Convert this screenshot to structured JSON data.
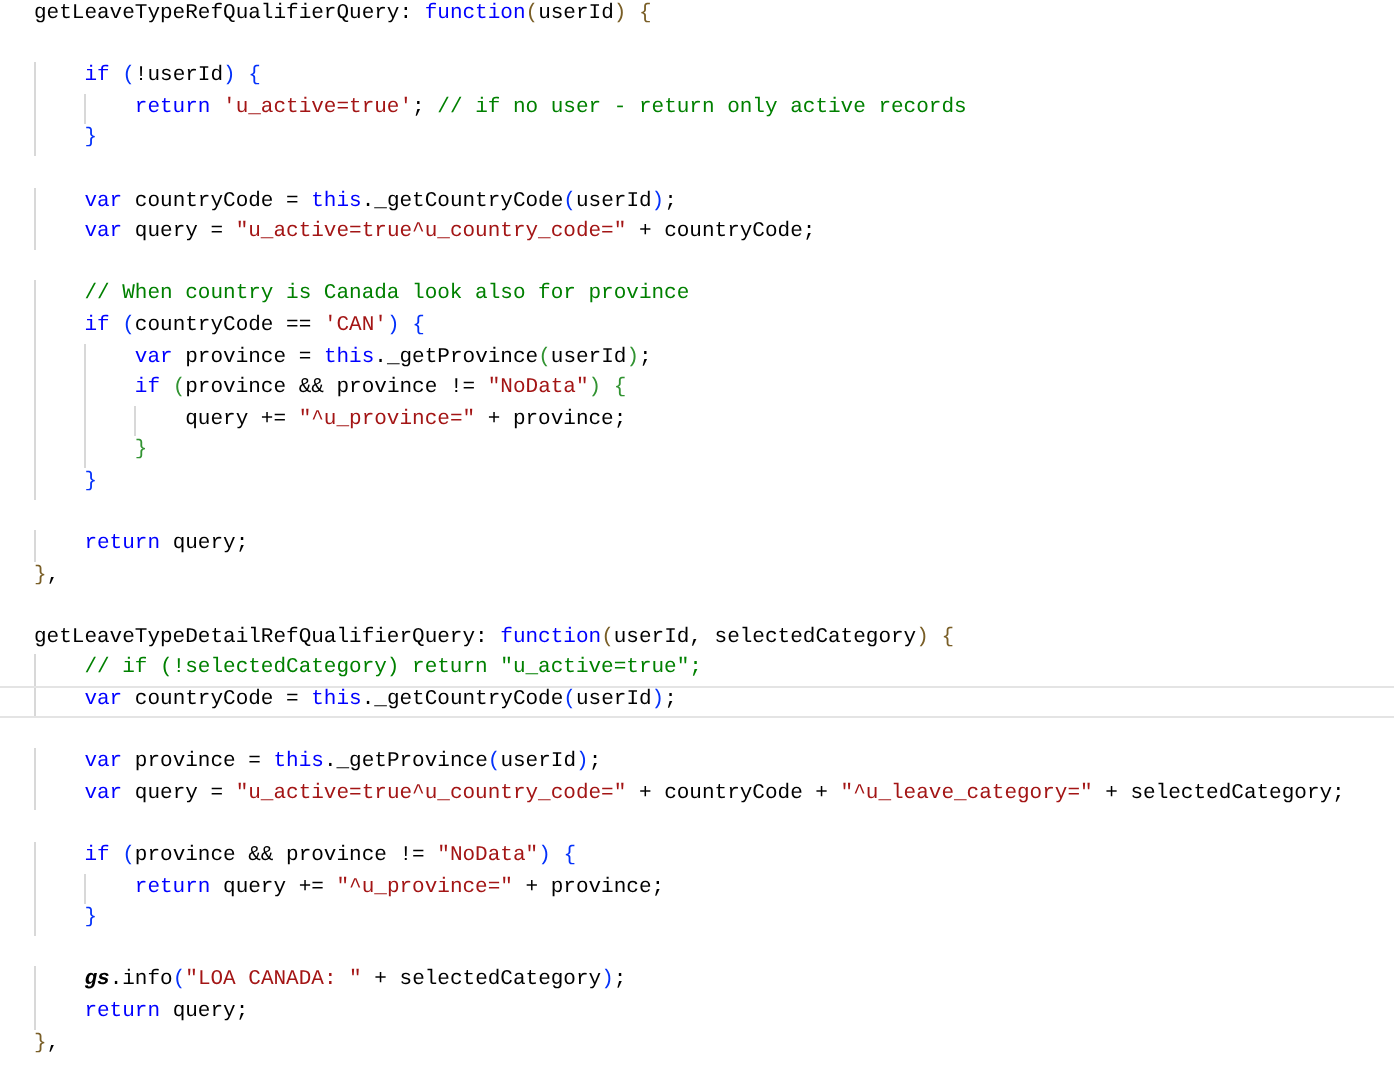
{
  "editor": {
    "lines": [
      {
        "kind": "code",
        "current": false,
        "tokens": [
          {
            "kind": "plain",
            "text": "getLeaveTypeRefQualifierQuery: "
          },
          {
            "kind": "kw",
            "text": "function"
          },
          {
            "kind": "b1",
            "text": "("
          },
          {
            "kind": "plain",
            "text": "userId"
          },
          {
            "kind": "b1",
            "text": ")"
          },
          {
            "kind": "b1",
            "text": " {"
          }
        ]
      },
      {
        "kind": "blank"
      },
      {
        "kind": "code",
        "current": false,
        "tokens": [
          {
            "kind": "kw",
            "text": "    if"
          },
          {
            "kind": "b2",
            "text": " ("
          },
          {
            "kind": "plain",
            "text": "!userId"
          },
          {
            "kind": "b2",
            "text": ")"
          },
          {
            "kind": "b2",
            "text": " {"
          }
        ]
      },
      {
        "kind": "code",
        "current": false,
        "tokens": [
          {
            "kind": "kw",
            "text": "        return"
          },
          {
            "kind": "str",
            "text": " 'u_active=true'"
          },
          {
            "kind": "plain",
            "text": ";"
          },
          {
            "kind": "comment",
            "text": " // if no user - return only active records"
          }
        ]
      },
      {
        "kind": "code",
        "current": false,
        "tokens": [
          {
            "kind": "b2",
            "text": "    }"
          }
        ]
      },
      {
        "kind": "blank"
      },
      {
        "kind": "code",
        "current": false,
        "tokens": [
          {
            "kind": "kw",
            "text": "    var"
          },
          {
            "kind": "plain",
            "text": " countryCode = "
          },
          {
            "kind": "kw",
            "text": "this"
          },
          {
            "kind": "plain",
            "text": "._getCountryCode"
          },
          {
            "kind": "b2",
            "text": "("
          },
          {
            "kind": "plain",
            "text": "userId"
          },
          {
            "kind": "b2",
            "text": ")"
          },
          {
            "kind": "plain",
            "text": ";"
          }
        ]
      },
      {
        "kind": "code",
        "current": false,
        "tokens": [
          {
            "kind": "kw",
            "text": "    var"
          },
          {
            "kind": "plain",
            "text": " query = "
          },
          {
            "kind": "str",
            "text": "\"u_active=true^u_country_code=\""
          },
          {
            "kind": "plain",
            "text": " + countryCode;"
          }
        ]
      },
      {
        "kind": "blank"
      },
      {
        "kind": "code",
        "current": false,
        "tokens": [
          {
            "kind": "comment",
            "text": "    // When country is Canada look also for province"
          }
        ]
      },
      {
        "kind": "code",
        "current": false,
        "tokens": [
          {
            "kind": "kw",
            "text": "    if"
          },
          {
            "kind": "b2",
            "text": " ("
          },
          {
            "kind": "plain",
            "text": "countryCode == "
          },
          {
            "kind": "str",
            "text": "'CAN'"
          },
          {
            "kind": "b2",
            "text": ")"
          },
          {
            "kind": "b2",
            "text": " {"
          }
        ]
      },
      {
        "kind": "code",
        "current": false,
        "tokens": [
          {
            "kind": "kw",
            "text": "        var"
          },
          {
            "kind": "plain",
            "text": " province = "
          },
          {
            "kind": "kw",
            "text": "this"
          },
          {
            "kind": "plain",
            "text": "._getProvince"
          },
          {
            "kind": "b3",
            "text": "("
          },
          {
            "kind": "plain",
            "text": "userId"
          },
          {
            "kind": "b3",
            "text": ")"
          },
          {
            "kind": "plain",
            "text": ";"
          }
        ]
      },
      {
        "kind": "code",
        "current": false,
        "tokens": [
          {
            "kind": "kw",
            "text": "        if"
          },
          {
            "kind": "b3",
            "text": " ("
          },
          {
            "kind": "plain",
            "text": "province && province != "
          },
          {
            "kind": "str",
            "text": "\"NoData\""
          },
          {
            "kind": "b3",
            "text": ")"
          },
          {
            "kind": "b3",
            "text": " {"
          }
        ]
      },
      {
        "kind": "code",
        "current": false,
        "tokens": [
          {
            "kind": "plain",
            "text": "            query += "
          },
          {
            "kind": "str",
            "text": "\"^u_province=\""
          },
          {
            "kind": "plain",
            "text": " + province;"
          }
        ]
      },
      {
        "kind": "code",
        "current": false,
        "tokens": [
          {
            "kind": "b3",
            "text": "        }"
          }
        ]
      },
      {
        "kind": "code",
        "current": false,
        "tokens": [
          {
            "kind": "b2",
            "text": "    }"
          }
        ]
      },
      {
        "kind": "blank"
      },
      {
        "kind": "code",
        "current": false,
        "tokens": [
          {
            "kind": "kw",
            "text": "    return"
          },
          {
            "kind": "plain",
            "text": " query;"
          }
        ]
      },
      {
        "kind": "code",
        "current": false,
        "tokens": [
          {
            "kind": "b1",
            "text": "}"
          },
          {
            "kind": "plain",
            "text": ","
          }
        ]
      },
      {
        "kind": "blank"
      },
      {
        "kind": "code",
        "current": false,
        "tokens": [
          {
            "kind": "plain",
            "text": "getLeaveTypeDetailRefQualifierQuery: "
          },
          {
            "kind": "kw",
            "text": "function"
          },
          {
            "kind": "b1",
            "text": "("
          },
          {
            "kind": "plain",
            "text": "userId, selectedCategory"
          },
          {
            "kind": "b1",
            "text": ")"
          },
          {
            "kind": "b1",
            "text": " {"
          }
        ]
      },
      {
        "kind": "code",
        "current": false,
        "tokens": [
          {
            "kind": "comment",
            "text": "    // if (!selectedCategory) return \"u_active=true\";"
          }
        ]
      },
      {
        "kind": "code",
        "current": true,
        "tokens": [
          {
            "kind": "kw",
            "text": "    var"
          },
          {
            "kind": "plain",
            "text": " countryCode = "
          },
          {
            "kind": "kw",
            "text": "this"
          },
          {
            "kind": "plain",
            "text": "._getCountryCode"
          },
          {
            "kind": "b2",
            "text": "("
          },
          {
            "kind": "plain",
            "text": "userId"
          },
          {
            "kind": "b2",
            "text": ")"
          },
          {
            "kind": "plain",
            "text": ";"
          }
        ]
      },
      {
        "kind": "blank"
      },
      {
        "kind": "code",
        "current": false,
        "tokens": [
          {
            "kind": "kw",
            "text": "    var"
          },
          {
            "kind": "plain",
            "text": " province = "
          },
          {
            "kind": "kw",
            "text": "this"
          },
          {
            "kind": "plain",
            "text": "._getProvince"
          },
          {
            "kind": "b2",
            "text": "("
          },
          {
            "kind": "plain",
            "text": "userId"
          },
          {
            "kind": "b2",
            "text": ")"
          },
          {
            "kind": "plain",
            "text": ";"
          }
        ]
      },
      {
        "kind": "code",
        "current": false,
        "tokens": [
          {
            "kind": "kw",
            "text": "    var"
          },
          {
            "kind": "plain",
            "text": " query = "
          },
          {
            "kind": "str",
            "text": "\"u_active=true^u_country_code=\""
          },
          {
            "kind": "plain",
            "text": " + countryCode + "
          },
          {
            "kind": "str",
            "text": "\"^u_leave_category=\""
          },
          {
            "kind": "plain",
            "text": " + selectedCategory;"
          }
        ]
      },
      {
        "kind": "blank"
      },
      {
        "kind": "code",
        "current": false,
        "tokens": [
          {
            "kind": "kw",
            "text": "    if"
          },
          {
            "kind": "b2",
            "text": " ("
          },
          {
            "kind": "plain",
            "text": "province && province != "
          },
          {
            "kind": "str",
            "text": "\"NoData\""
          },
          {
            "kind": "b2",
            "text": ")"
          },
          {
            "kind": "b2",
            "text": " {"
          }
        ]
      },
      {
        "kind": "code",
        "current": false,
        "tokens": [
          {
            "kind": "kw",
            "text": "        return"
          },
          {
            "kind": "plain",
            "text": " query += "
          },
          {
            "kind": "str",
            "text": "\"^u_province=\""
          },
          {
            "kind": "plain",
            "text": " + province;"
          }
        ]
      },
      {
        "kind": "code",
        "current": false,
        "tokens": [
          {
            "kind": "b2",
            "text": "    }"
          }
        ]
      },
      {
        "kind": "blank"
      },
      {
        "kind": "code",
        "current": false,
        "tokens": [
          {
            "kind": "global",
            "text": "    gs"
          },
          {
            "kind": "plain",
            "text": ".info"
          },
          {
            "kind": "b2",
            "text": "("
          },
          {
            "kind": "str",
            "text": "\"LOA CANADA: \""
          },
          {
            "kind": "plain",
            "text": " + selectedCategory"
          },
          {
            "kind": "b2",
            "text": ")"
          },
          {
            "kind": "plain",
            "text": ";"
          }
        ]
      },
      {
        "kind": "code",
        "current": false,
        "tokens": [
          {
            "kind": "kw",
            "text": "    return"
          },
          {
            "kind": "plain",
            "text": " query;"
          }
        ]
      },
      {
        "kind": "code",
        "current": false,
        "tokens": [
          {
            "kind": "b1",
            "text": "}"
          },
          {
            "kind": "plain",
            "text": ","
          }
        ]
      }
    ]
  }
}
